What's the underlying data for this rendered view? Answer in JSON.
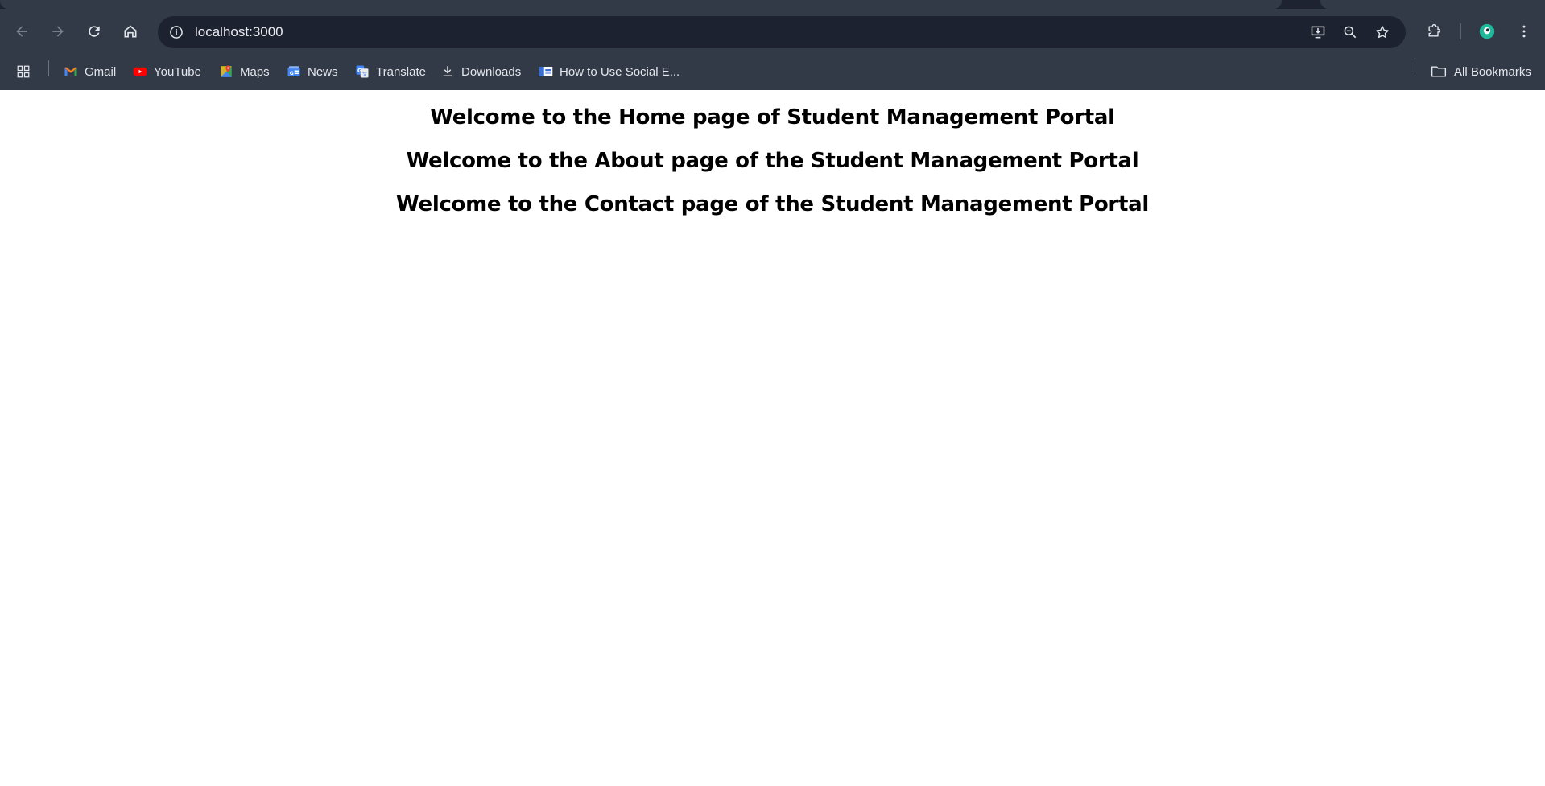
{
  "browser": {
    "url": "localhost:3000",
    "bookmarks": [
      {
        "label": "Gmail",
        "icon": "gmail-icon"
      },
      {
        "label": "YouTube",
        "icon": "youtube-icon"
      },
      {
        "label": "Maps",
        "icon": "maps-icon"
      },
      {
        "label": "News",
        "icon": "news-icon"
      },
      {
        "label": "Translate",
        "icon": "translate-icon"
      },
      {
        "label": "Downloads",
        "icon": "download-icon"
      },
      {
        "label": "How to Use Social E...",
        "icon": "page-favicon-icon"
      }
    ],
    "all_bookmarks_label": "All Bookmarks",
    "colors": {
      "toolbar": "#323a48",
      "omnibox": "#1c2230",
      "profile": "#1fb89a"
    }
  },
  "page": {
    "headings": [
      "Welcome to the Home page of Student Management Portal",
      "Welcome to the About page of the Student Management Portal",
      "Welcome to the Contact page of the Student Management Portal"
    ]
  }
}
